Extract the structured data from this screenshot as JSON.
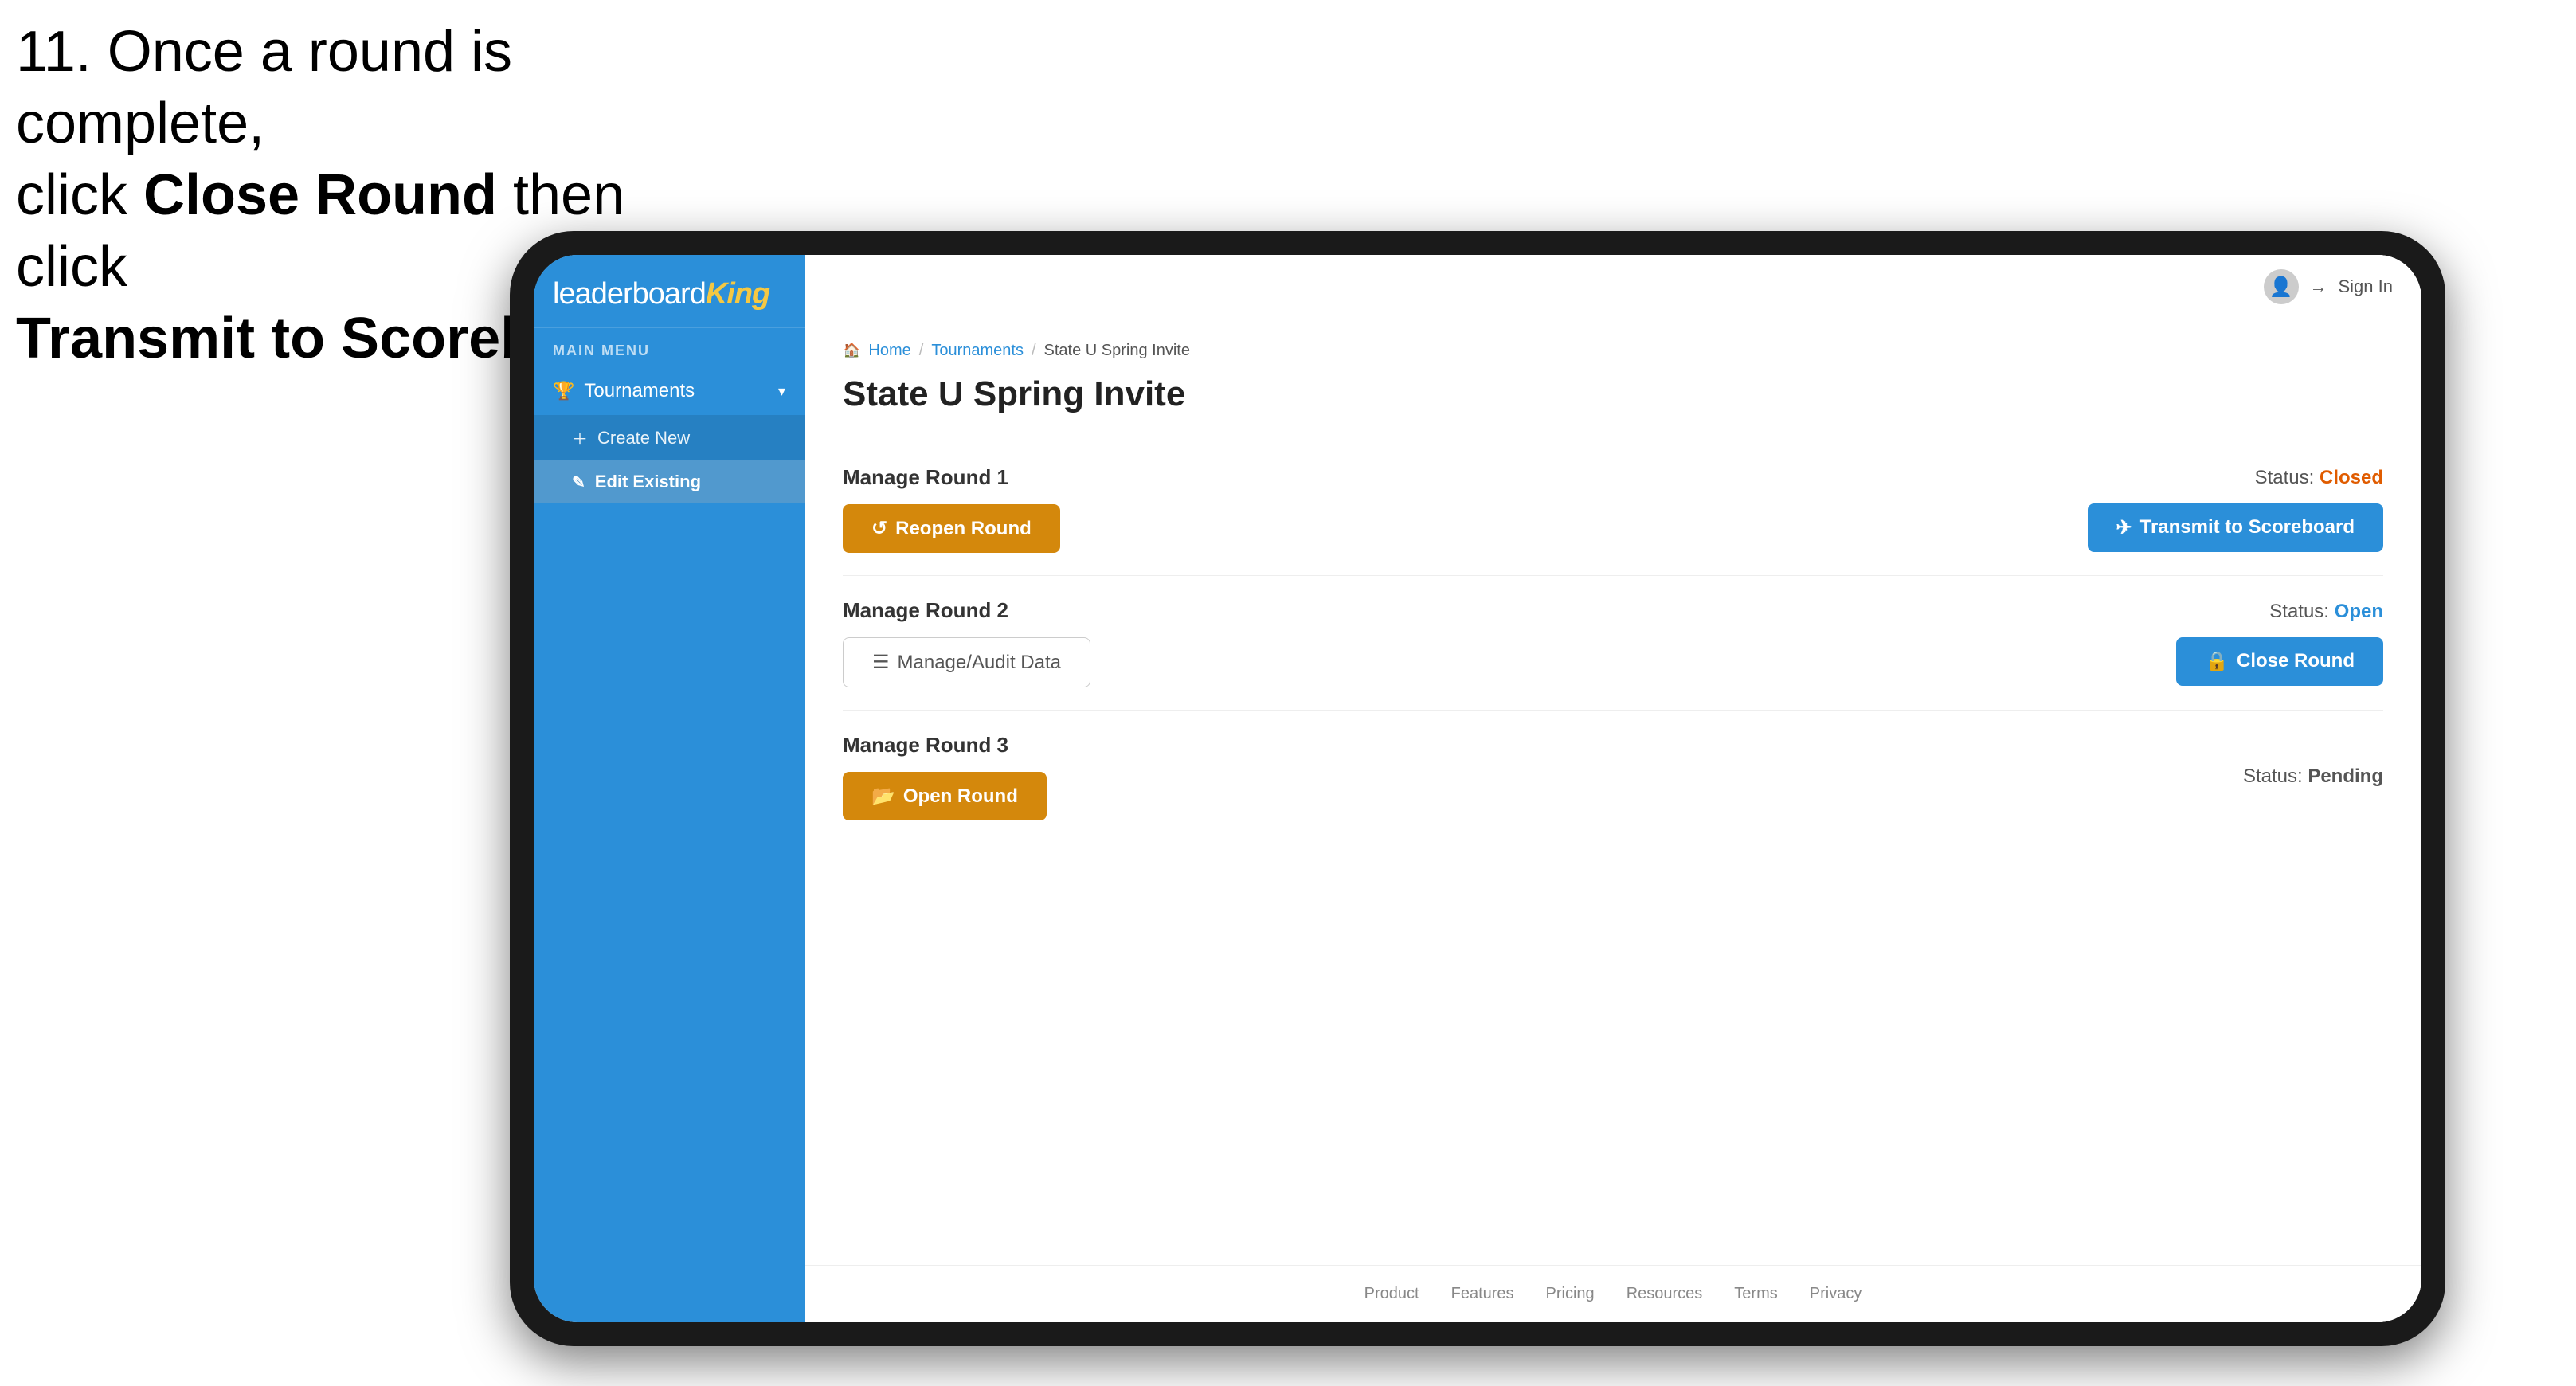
{
  "instruction": {
    "line1": "11. Once a round is complete,",
    "line2": "click ",
    "bold1": "Close Round",
    "line3": " then click",
    "bold2": "Transmit to Scoreboard."
  },
  "sidebar": {
    "logo": {
      "leaderboard": "leaderboard",
      "king": "King"
    },
    "menu_label": "MAIN MENU",
    "items": [
      {
        "label": "Tournaments",
        "icon": "trophy",
        "has_children": true,
        "expanded": true
      }
    ],
    "sub_items": [
      {
        "label": "Create New",
        "icon": "plus"
      },
      {
        "label": "Edit Existing",
        "icon": "edit",
        "active": true
      }
    ]
  },
  "topbar": {
    "sign_in": "Sign In"
  },
  "breadcrumb": {
    "home": "Home",
    "tournaments": "Tournaments",
    "current": "State U Spring Invite"
  },
  "page_title": "State U Spring Invite",
  "rounds": [
    {
      "id": "round1",
      "title": "Manage Round 1",
      "status_label": "Status:",
      "status_value": "Closed",
      "status_class": "status-closed",
      "primary_button": {
        "label": "Reopen Round",
        "style": "btn-gold",
        "icon": "↺"
      },
      "secondary_button": {
        "label": "Transmit to Scoreboard",
        "style": "btn-blue",
        "icon": "✈"
      }
    },
    {
      "id": "round2",
      "title": "Manage Round 2",
      "status_label": "Status:",
      "status_value": "Open",
      "status_class": "status-open",
      "primary_button": {
        "label": "Manage/Audit Data",
        "style": "btn-outline",
        "icon": "☰"
      },
      "secondary_button": {
        "label": "Close Round",
        "style": "btn-blue",
        "icon": "🔒"
      }
    },
    {
      "id": "round3",
      "title": "Manage Round 3",
      "status_label": "Status:",
      "status_value": "Pending",
      "status_class": "status-pending",
      "primary_button": {
        "label": "Open Round",
        "style": "btn-gold",
        "icon": "📂"
      },
      "secondary_button": null
    }
  ],
  "footer": {
    "links": [
      "Product",
      "Features",
      "Pricing",
      "Resources",
      "Terms",
      "Privacy"
    ]
  }
}
